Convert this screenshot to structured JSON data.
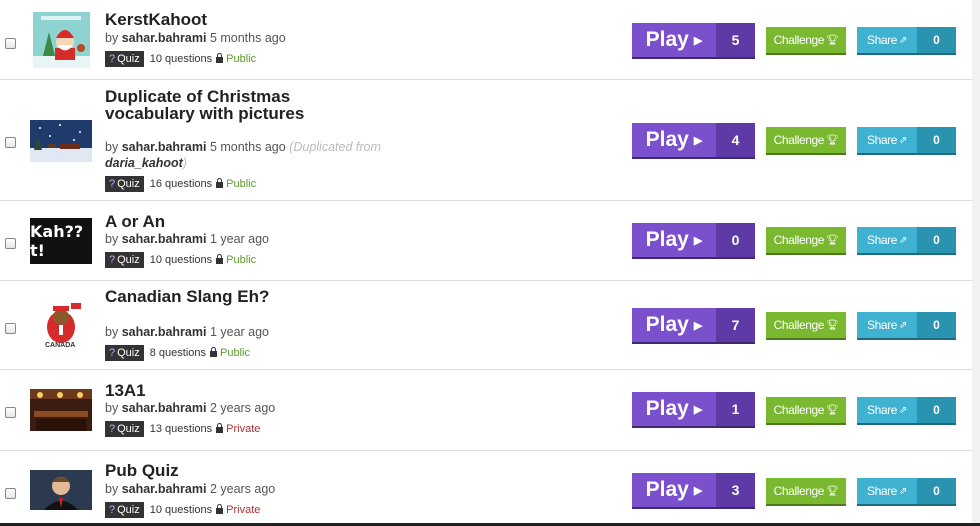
{
  "items": [
    {
      "title": "KerstKahoot",
      "author_prefix": "by",
      "author": "sahar.bahrami",
      "age": "5 months ago",
      "type": "Quiz",
      "questions": "10 questions",
      "visibility": "Public",
      "plays": "5",
      "shares": "0"
    },
    {
      "title": "Duplicate of Christmas vocabulary with pictures",
      "author_prefix": "by",
      "author": "sahar.bahrami",
      "age": "5 months ago",
      "dup_note": "(Duplicated from",
      "dup_from": "daria_kahoot",
      "dup_close": ")",
      "type": "Quiz",
      "questions": "16 questions",
      "visibility": "Public",
      "plays": "4",
      "shares": "0"
    },
    {
      "title": "A or An",
      "author_prefix": "by",
      "author": "sahar.bahrami",
      "age": "1 year ago",
      "type": "Quiz",
      "questions": "10 questions",
      "visibility": "Public",
      "plays": "0",
      "shares": "0"
    },
    {
      "title": "Canadian Slang Eh?",
      "author_prefix": "by",
      "author": "sahar.bahrami",
      "age": "1 year ago",
      "type": "Quiz",
      "questions": "8 questions",
      "visibility": "Public",
      "plays": "7",
      "shares": "0"
    },
    {
      "title": "13A1",
      "author_prefix": "by",
      "author": "sahar.bahrami",
      "age": "2 years ago",
      "type": "Quiz",
      "questions": "13 questions",
      "visibility": "Private",
      "plays": "1",
      "shares": "0"
    },
    {
      "title": "Pub Quiz",
      "author_prefix": "by",
      "author": "sahar.bahrami",
      "age": "2 years ago",
      "type": "Quiz",
      "questions": "10 questions",
      "visibility": "Private",
      "plays": "3",
      "shares": "0"
    }
  ],
  "thumbs": {
    "kahoot_logo": "Kah??t!",
    "canada": "CANADA"
  },
  "labels": {
    "play": "Play",
    "challenge": "Challenge",
    "share": "Share",
    "quiz_mark": "?"
  },
  "colors": {
    "play": "#7a50cc",
    "play_count": "#5e3aa6",
    "challenge": "#7ab830",
    "share": "#3fb2d1",
    "share_count": "#2a93b0",
    "public": "#5c9b29",
    "private": "#aa3333"
  },
  "icons": {
    "play": "play-triangle-icon",
    "challenge": "trophy-icon",
    "share": "share-external-icon",
    "lock": "lock-icon"
  }
}
